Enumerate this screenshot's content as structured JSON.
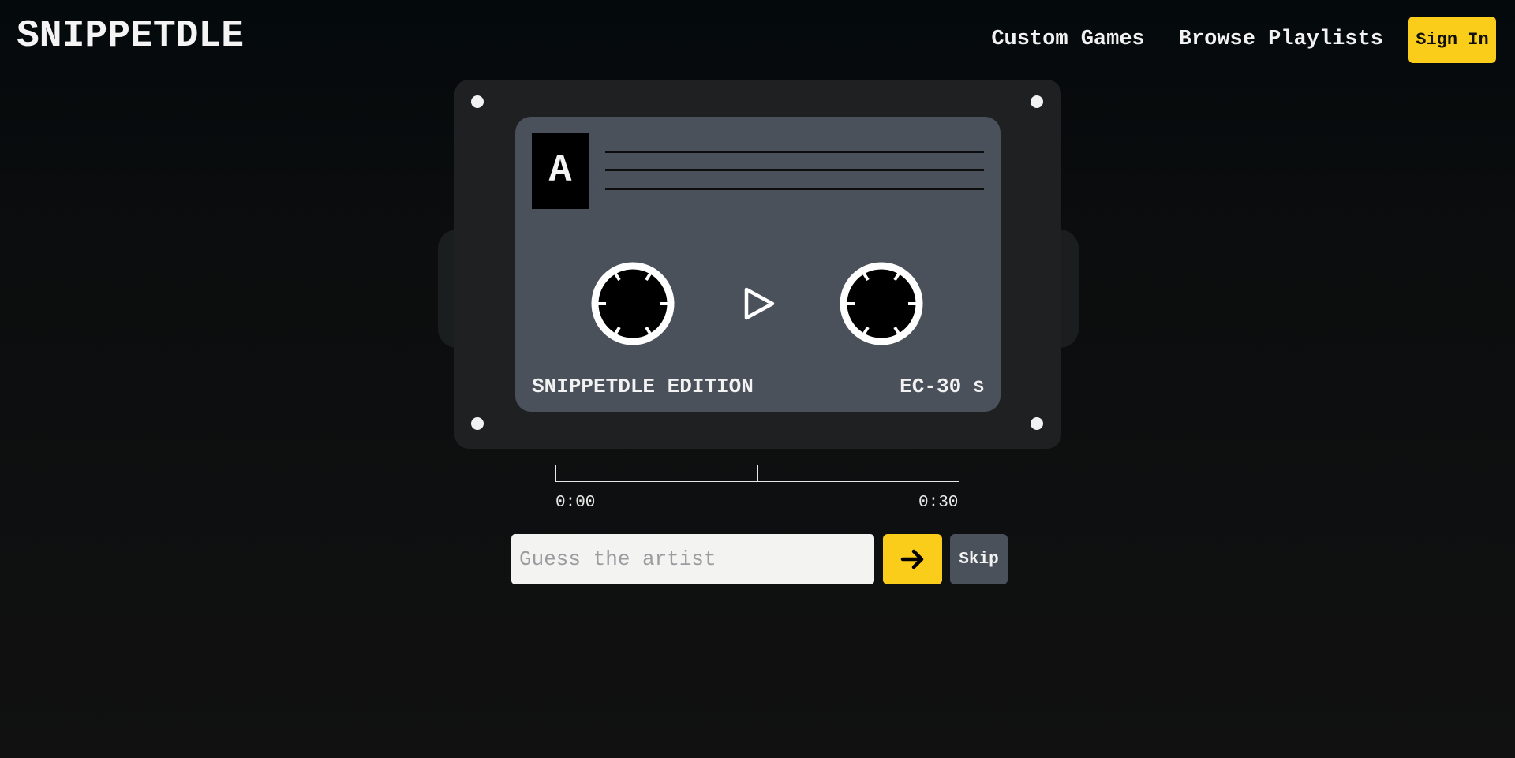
{
  "header": {
    "logo": "SNIPPETDLE",
    "nav": [
      {
        "label": "Custom Games"
      },
      {
        "label": "Browse Playlists"
      }
    ],
    "sign_in_label": "Sign In"
  },
  "cassette": {
    "side": "A",
    "edition_label": "SNIPPETDLE EDITION",
    "model_label": "EC-30",
    "model_suffix": "S",
    "play_icon": "play-icon",
    "reel_icon": "reel-icon"
  },
  "player": {
    "segments": 6,
    "progress": 0,
    "time_start": "0:00",
    "time_end": "0:30"
  },
  "guess": {
    "placeholder": "Guess the artist",
    "value": "",
    "submit_icon": "arrow-right-icon",
    "skip_label": "Skip"
  },
  "colors": {
    "accent": "#fbcd1b",
    "background": "#0b0d0e",
    "cassette_body": "#1e2022",
    "cassette_label": "#4b515b",
    "text": "#f2f2f2"
  }
}
